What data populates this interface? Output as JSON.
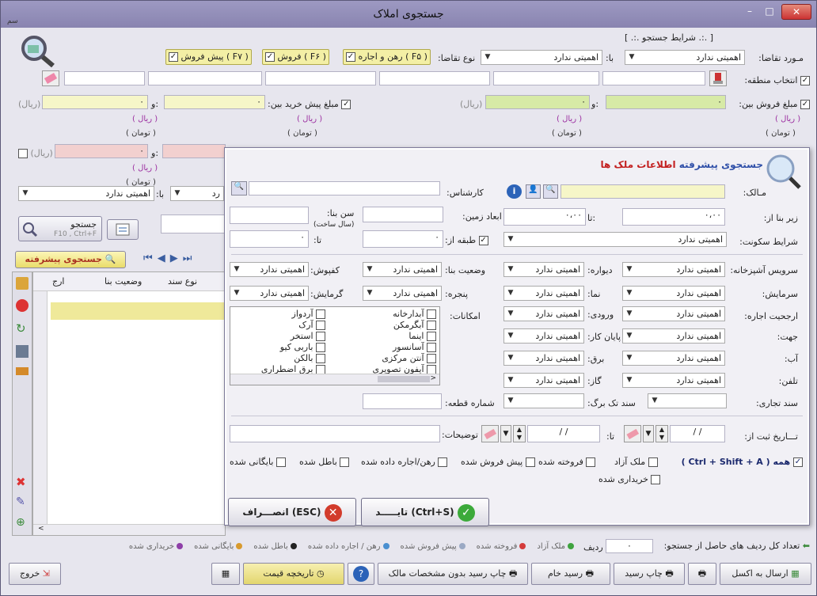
{
  "window": {
    "title": "جستجوی املاک",
    "sys_label": "سم"
  },
  "criteria": {
    "panel_title": "[ .:. شرایط جستجو .:. ]",
    "request_type_label": "مـورد تقاضا:",
    "request_type_value": "اهمیتی ندارد",
    "with_label": "با:",
    "with_value": "اهمیتی ندارد",
    "demand_kind_label": "نوع تقاضا:",
    "rent_label": "رهن و اجاره ( F۵ )",
    "sale_label": "فروش ( F۶ )",
    "presale_label": "پیش فروش ( F۷ )",
    "region_label": "انتخاب منطقه:",
    "sale_amount_label": "مبلغ فروش بین:",
    "presale_amount_label": "مبلغ پیش خرید بین:",
    "and_label": "و:",
    "zero": "۰",
    "rial_paren": "(ریال)",
    "rial": "( ریال )",
    "toman": "( تومان )",
    "with_value2": "اهمیتی ندارد",
    "with_label2": "با:",
    "rd": "رد"
  },
  "search_button": {
    "label": "جستجو",
    "shortcut": "F10 , Ctrl+F"
  },
  "advanced_search": {
    "label": "جستجوی پیشرفته"
  },
  "grid": {
    "headers": [
      "ارج",
      "وضعیت بنا",
      "نوع سند"
    ]
  },
  "dialog": {
    "title_prefix": "جستجوی پیشرفته",
    "title_suffix": "اطلاعات ملک ها",
    "owner_label": "مـالک:",
    "expert_label": "کارشناس:",
    "area_from_label": "زیر بنا از:",
    "to_label": "تا:",
    "area_from": "۰،۰۰",
    "area_to": "۰،۰۰",
    "land_dims_label": "ابعاد زمین:",
    "building_age_label": "سن بنا:",
    "building_age_sub": "(سال ساخت)",
    "residence_label": "شرایط سکونت:",
    "residence_value": "اهمیتی ندارد",
    "floor_from_label": "طبقه از:",
    "floor_from": "۰",
    "to2_label": "تا:",
    "to2_value": "۰",
    "kitchen_label": "سرویس آشپزخانه:",
    "kitchen_value": "اهمیتی ندارد",
    "wall_label": "دیواره:",
    "wall_value": "اهمیتی ندارد",
    "building_state_label": "وضعیت بنا:",
    "building_state_value": "اهمیتی ندارد",
    "flooring_label": "کفپوش:",
    "flooring_value": "اهمیتی ندارد",
    "cooling_label": "سرمایش:",
    "cooling_value": "اهمیتی ندارد",
    "facade_label": "نما:",
    "facade_value": "اهمیتی ندارد",
    "window_label": "پنجره:",
    "window_value": "اهمیتی ندارد",
    "heating_label": "گرمایش:",
    "heating_value": "اهمیتی ندارد",
    "rent_priority_label": "ارجحیت اجاره:",
    "rent_priority_value": "اهمیتی ندارد",
    "entrance_label": "ورودی:",
    "entrance_value": "اهمیتی ندارد",
    "facilities_label": "امکانات:",
    "facilities_col1": [
      "آبدارخانه",
      "آبگرمکن",
      "آیفون تصویری"
    ],
    "facilities_col1_mid": [
      "اینما",
      "آسانسور",
      "آنتن مرکزی"
    ],
    "facilities_col2": [
      "آردواز",
      "آرک",
      "استخر",
      "باربی کیو",
      "بالکن",
      "برق اضطراری"
    ],
    "direction_label": "جهت:",
    "direction_value": "اهمیتی ندارد",
    "finish_label": "پایان کار:",
    "finish_value": "اهمیتی ندارد",
    "water_label": "آب:",
    "water_value": "اهمیتی ندارد",
    "electric_label": "برق:",
    "electric_value": "اهمیتی ندارد",
    "phone_label": "تلفن:",
    "phone_value": "اهمیتی ندارد",
    "gas_label": "گاز:",
    "gas_value": "اهمیتی ندارد",
    "commercial_doc_label": "سند تجاری:",
    "single_doc_label": "سند تک برگ:",
    "parcel_label": "شماره قطعه:",
    "reg_date_label": "تـــاریخ ثبت از:",
    "reg_to_label": "تا:",
    "date_placeholder": "/ /",
    "notes_label": "توضیحات:",
    "status_all": "همه ( Ctrl + Shift + A )",
    "status_free": "ملک آزاد",
    "status_sold": "فروخته شده",
    "status_presold": "پیش فروش شده",
    "status_rented": "رهن/اجاره داده شده",
    "status_cancelled": "باطل شده",
    "status_archived": "بایگانی شده",
    "status_bought": "خریداری شده",
    "ok_label": "تایـــــد (Ctrl+S)",
    "cancel_label": "انصـــراف (ESC)"
  },
  "footer": {
    "rows_label": "تعداد کل ردیف های حاصل از جستجو:",
    "rows_value": "۰",
    "row_unit": "ردیف",
    "legend": [
      {
        "label": "ملک آزاد",
        "color": "#3fa33f"
      },
      {
        "label": "فروخته شده",
        "color": "#d43b3b"
      },
      {
        "label": "پیش فروش شده",
        "color": "#9aa9c4"
      },
      {
        "label": "رهن / اجاره داده شده",
        "color": "#4a8fd0"
      },
      {
        "label": "باطل شده",
        "color": "#222222"
      },
      {
        "label": "بایگانی شده",
        "color": "#d89a2e"
      },
      {
        "label": "خریداری شده",
        "color": "#8e3fa8"
      }
    ],
    "excel_label": "ارسال به اکسل",
    "print_receipt_label": "چاپ رسید",
    "raw_receipt_label": "رسید خام",
    "print_no_owner_label": "چاپ رسید بدون مشخصات مالک",
    "price_history_label": "تاریخچه قیمت",
    "exit_label": "خروج"
  }
}
